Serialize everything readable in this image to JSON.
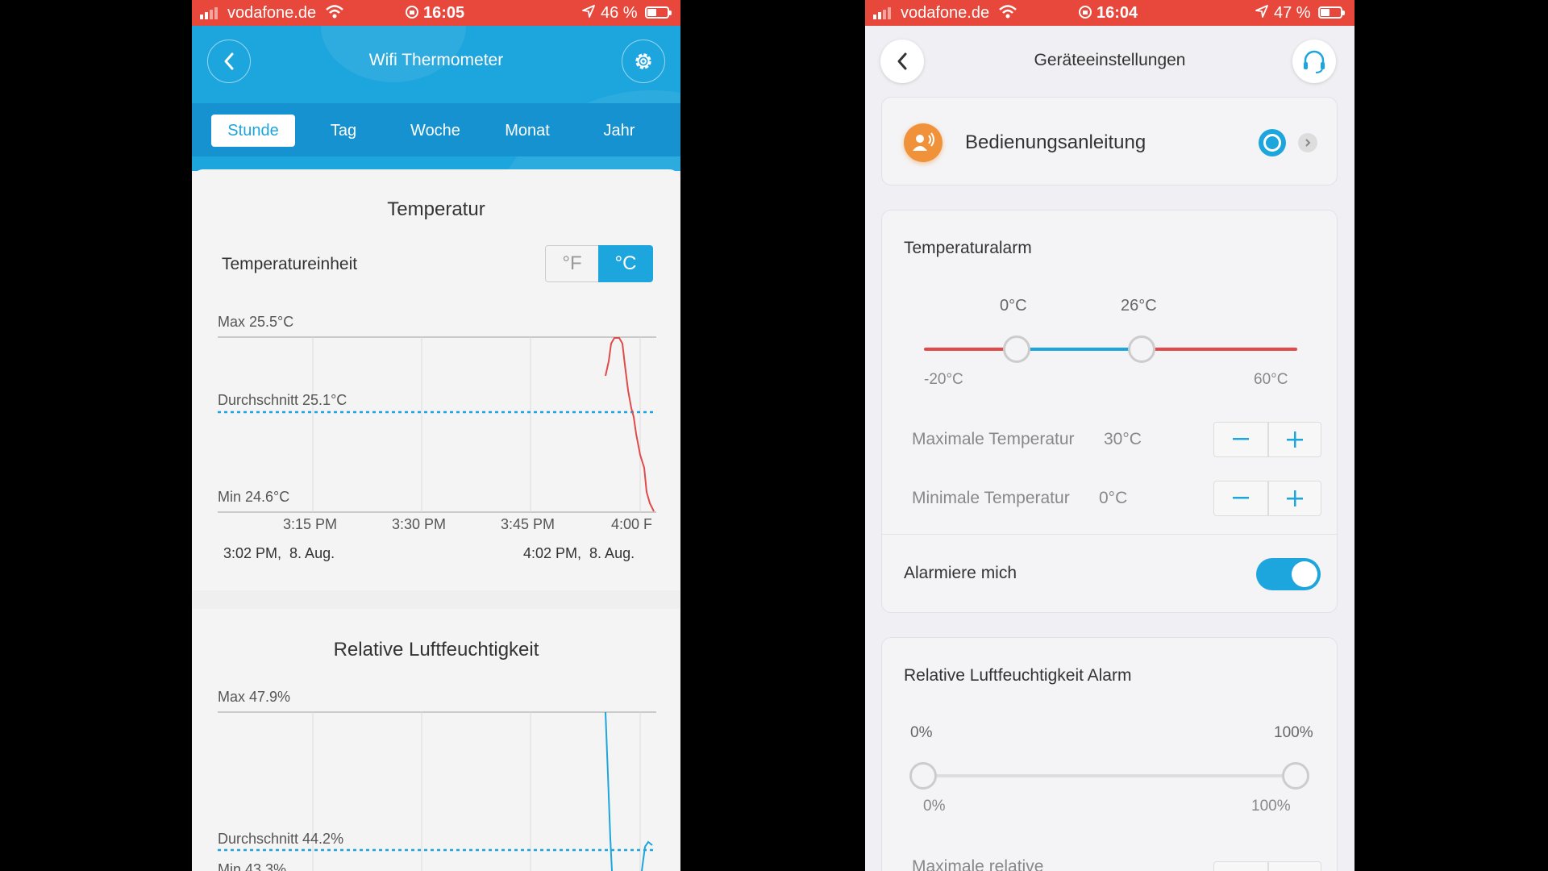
{
  "left_screen": {
    "status": {
      "carrier": "vodafone.de",
      "time": "16:05",
      "battery": "46 %"
    },
    "header": {
      "title": "Wifi Thermometer"
    },
    "tabs": [
      {
        "label": "Stunde",
        "active": true
      },
      {
        "label": "Tag",
        "active": false
      },
      {
        "label": "Woche",
        "active": false
      },
      {
        "label": "Monat",
        "active": false
      },
      {
        "label": "Jahr",
        "active": false
      }
    ],
    "temperature": {
      "title": "Temperatur",
      "unit_label": "Temperatureinheit",
      "unit_f": "°F",
      "unit_c": "°C",
      "selected_unit": "°C",
      "max_label": "Max 25.5°C",
      "avg_label": "Durchschnitt 25.1°C",
      "min_label": "Min 24.6°C",
      "x_ticks": [
        "3:15 PM",
        "3:30 PM",
        "3:45 PM",
        "4:00 F"
      ],
      "start_label": "3:02 PM,  8. Aug.",
      "end_label": "4:02 PM,  8. Aug."
    },
    "humidity": {
      "title": "Relative Luftfeuchtigkeit",
      "max_label": "Max 47.9%",
      "avg_label": "Durchschnitt 44.2%",
      "min_label": "Min 43.3%"
    }
  },
  "right_screen": {
    "status": {
      "carrier": "vodafone.de",
      "time": "16:04",
      "battery": "47 %"
    },
    "header": {
      "title": "Geräteeinstellungen"
    },
    "manual": {
      "label": "Bedienungsanleitung"
    },
    "temp_alarm": {
      "title": "Temperaturalarm",
      "low_value": "0°C",
      "high_value": "26°C",
      "range_min": "-20°C",
      "range_max": "60°C",
      "max_temp_label": "Maximale Temperatur",
      "max_temp_value": "30°C",
      "min_temp_label": "Minimale Temperatur",
      "min_temp_value": "0°C",
      "alarm_label": "Alarmiere mich",
      "alarm_on": true
    },
    "humidity_alarm": {
      "title": "Relative Luftfeuchtigkeit Alarm",
      "low_value": "0%",
      "high_value": "100%",
      "range_min": "0%",
      "range_max": "100%",
      "max_label": "Maximale relative"
    }
  },
  "colors": {
    "accent": "#1da5dd",
    "status_bar": "#e8483c",
    "temp_line": "#e24a4a",
    "alarm_orange": "#f0923a"
  }
}
